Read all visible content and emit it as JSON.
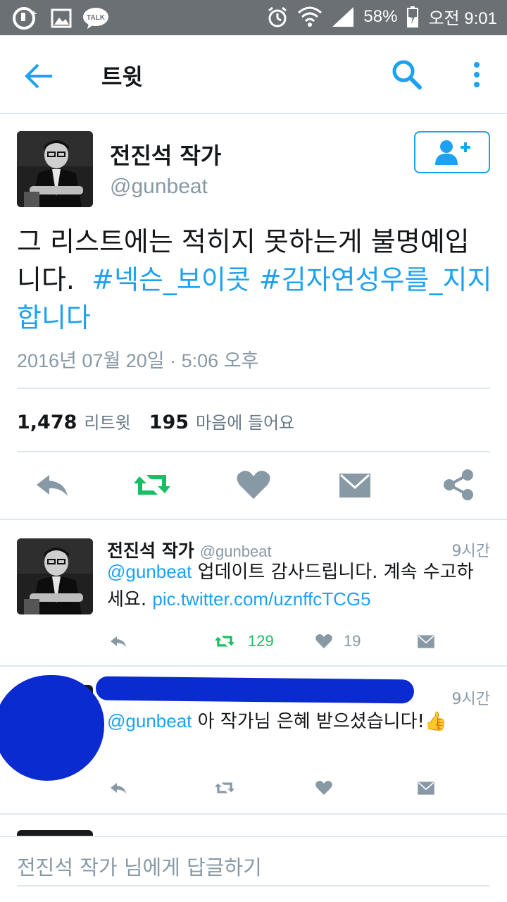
{
  "status_bar": {
    "battery": "58%",
    "time": "오전 9:01",
    "left_icons": [
      "u-plus-icon",
      "gallery-icon",
      "kakaotalk-icon"
    ],
    "talk_label": "TALK"
  },
  "toolbar": {
    "title": "트윗"
  },
  "tweet": {
    "author_name": "전진석 작가",
    "author_handle": "@gunbeat",
    "text_plain": "그 리스트에는 적히지 못하는게 불명예입니다.",
    "hashtag_1": "#넥슨_보이콧",
    "hashtag_2": "#김자연성우를_지지합니다",
    "date": "2016년 07월 20일 · 5:06 오후",
    "retweet_count": "1,478",
    "retweet_label": "리트윗",
    "like_count": "195",
    "like_label": "마음에 들어요"
  },
  "replies": [
    {
      "author_name": "전진석 작가",
      "author_handle": "@gunbeat",
      "time": "9시간",
      "mention": "@gunbeat",
      "text": "업데이트 감사드립니다. 계속 수고하세요.",
      "link": "pic.twitter.com/uznffcTCG5",
      "retweet_count": "129",
      "like_count": "19"
    },
    {
      "time": "9시간",
      "mention": "@gunbeat",
      "text": "아 작가님 은혜 받으셨습니다!",
      "emoji": "👍"
    }
  ],
  "reply_bar": {
    "placeholder": "전진석 작가 님에게 답글하기"
  },
  "colors": {
    "accent": "#1da1f2",
    "retweet_green": "#17bf63",
    "icon_gray": "#8899a6",
    "redaction_blue": "#0a2bd0"
  }
}
